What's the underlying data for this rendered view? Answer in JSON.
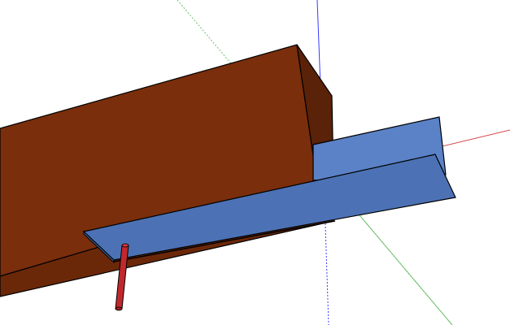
{
  "app": {
    "view": "3d-modeling-viewport"
  },
  "scene": {
    "background": "#ffffff",
    "axes": {
      "red_axis": "#d44a4a",
      "green_axis": "#6fbf6f",
      "blue_axis": "#3a3aff"
    },
    "objects": [
      {
        "name": "wooden-beam",
        "kind": "box",
        "color_front": "#7a2e0c",
        "color_top": "#8b3710",
        "color_side": "#5a2208"
      },
      {
        "name": "angle-bracket",
        "kind": "l-profile",
        "color_face": "#5b82c7",
        "color_top": "#4c72b5",
        "color_edge": "#3b5f9e"
      },
      {
        "name": "pin",
        "kind": "cylinder",
        "color": "#c0282c"
      }
    ]
  }
}
